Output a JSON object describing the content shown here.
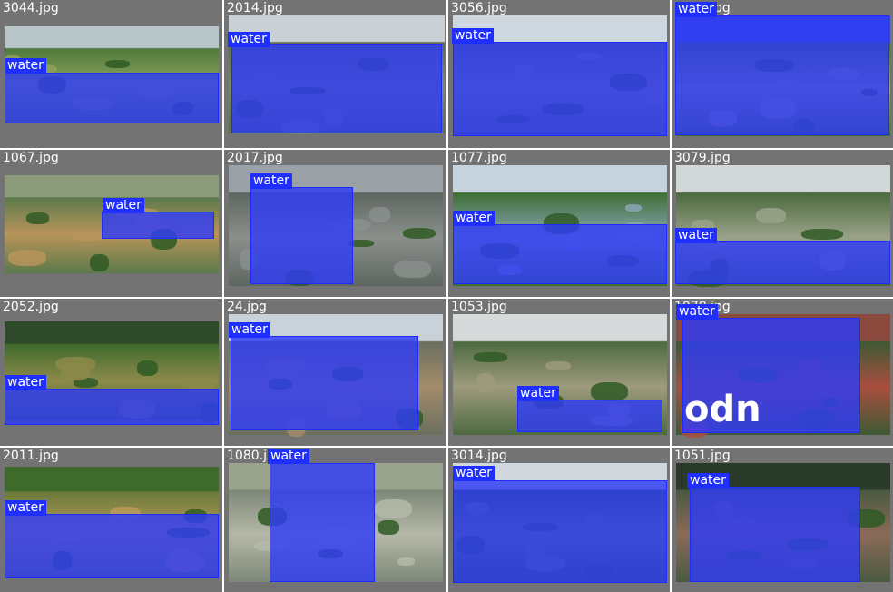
{
  "grid": {
    "detection_label": "water",
    "box_color": "#1f2fff",
    "cell_background": "#737373",
    "cells": [
      {
        "filename": "3044.jpg"
      },
      {
        "filename": "2014.jpg"
      },
      {
        "filename": "3056.jpg"
      },
      {
        "filename": "3011.jpg"
      },
      {
        "filename": "1067.jpg"
      },
      {
        "filename": "2017.jpg"
      },
      {
        "filename": "1077.jpg"
      },
      {
        "filename": "3079.jpg"
      },
      {
        "filename": "2052.jpg"
      },
      {
        "filename": "24.jpg"
      },
      {
        "filename": "1053.jpg"
      },
      {
        "filename": "1078.jpg",
        "watermark": "odn"
      },
      {
        "filename": "2011.jpg"
      },
      {
        "filename": "1080.jpg"
      },
      {
        "filename": "3014.jpg"
      },
      {
        "filename": "1051.jpg"
      }
    ]
  }
}
